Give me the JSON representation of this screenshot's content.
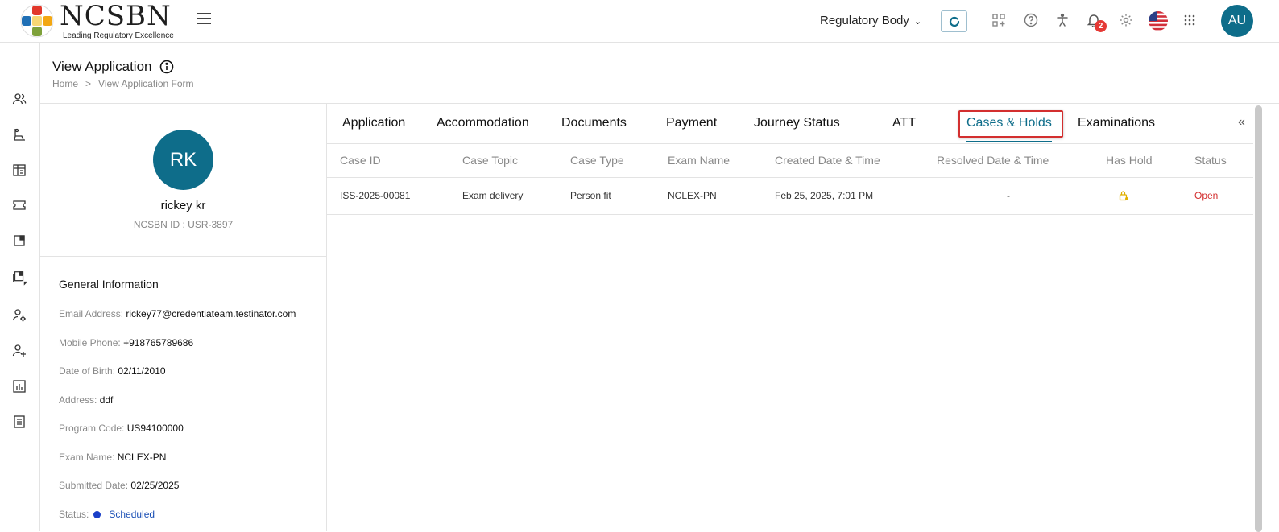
{
  "header": {
    "logo_text": "NCSBN",
    "logo_tagline": "Leading Regulatory Excellence",
    "role_selector": "Regulatory Body",
    "notification_count": "2",
    "user_initials": "AU"
  },
  "page": {
    "title": "View Application",
    "breadcrumb": [
      "Home",
      "View Application Form"
    ]
  },
  "profile": {
    "initials": "RK",
    "name": "rickey kr",
    "ncsbn_id": "NCSBN ID : USR-3897",
    "section_title": "General Information",
    "fields": [
      {
        "label": "Email Address:",
        "value": "rickey77@credentiateam.testinator.com"
      },
      {
        "label": "Mobile Phone:",
        "value": "+918765789686"
      },
      {
        "label": "Date of Birth:",
        "value": "02/11/2010"
      },
      {
        "label": "Address:",
        "value": "ddf"
      },
      {
        "label": "Program Code:",
        "value": "US94100000"
      },
      {
        "label": "Exam Name:",
        "value": "NCLEX-PN"
      },
      {
        "label": "Submitted Date:",
        "value": "02/25/2025"
      },
      {
        "label": "Status:",
        "value": "Scheduled"
      }
    ]
  },
  "tabs": [
    "Application",
    "Accommodation",
    "Documents",
    "Payment",
    "Journey Status",
    "ATT",
    "Cases & Holds",
    "Examinations"
  ],
  "active_tab": "Cases & Holds",
  "collapse_icon": "«",
  "table": {
    "columns": [
      "Case ID",
      "Case Topic",
      "Case Type",
      "Exam Name",
      "Created Date & Time",
      "Resolved Date & Time",
      "Has Hold",
      "Status"
    ],
    "rows": [
      {
        "case_id": "ISS-2025-00081",
        "topic": "Exam delivery",
        "type": "Person fit",
        "exam": "NCLEX-PN",
        "created": "Feb 25, 2025, 7:01 PM",
        "resolved": "-",
        "has_hold": "lock-icon",
        "status": "Open"
      }
    ]
  },
  "colors": {
    "brand": "#0e6d8a",
    "status_open": "#d32f2f",
    "highlight": "#d32f2f",
    "scheduled": "#1a3fc8"
  }
}
